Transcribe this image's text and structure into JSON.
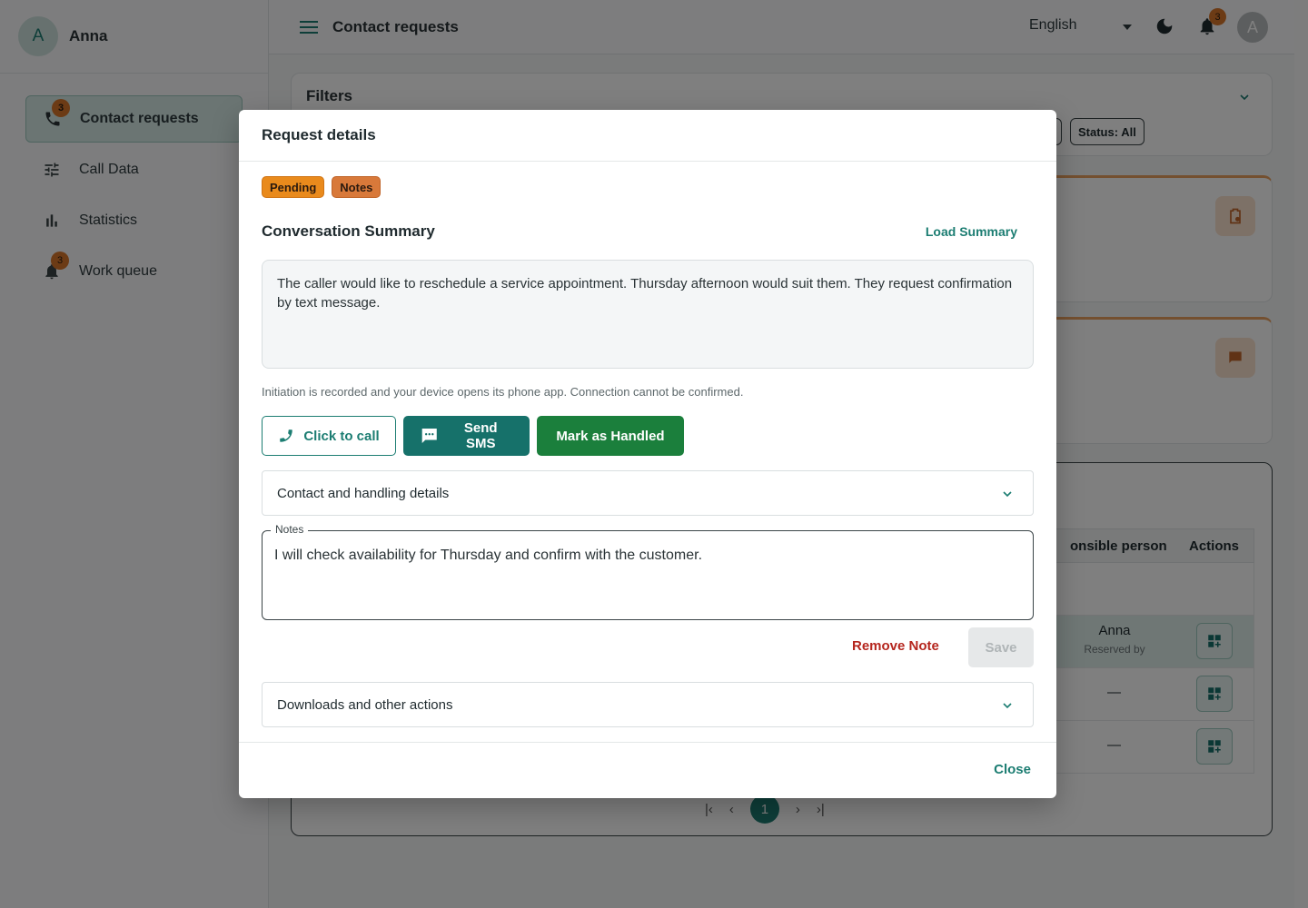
{
  "user": {
    "initial": "A",
    "name": "Anna"
  },
  "sidebar": {
    "items": [
      {
        "label": "Contact requests",
        "icon": "phone-icon",
        "badge": "3",
        "active": true
      },
      {
        "label": "Call Data",
        "icon": "sliders-icon",
        "badge": null
      },
      {
        "label": "Statistics",
        "icon": "bar-chart-icon",
        "badge": null
      },
      {
        "label": "Work queue",
        "icon": "bell-icon",
        "badge": "3"
      }
    ]
  },
  "topbar": {
    "title": "Contact requests",
    "language": "English",
    "notification_count": "3",
    "avatar_initial": "A"
  },
  "filters": {
    "title": "Filters",
    "chip_status": "Status: All"
  },
  "table": {
    "headers": {
      "responsible": "onsible person",
      "actions": "Actions"
    },
    "rows": [
      {
        "person": "",
        "person_sub": ""
      },
      {
        "person": "Anna",
        "person_sub": "Reserved by"
      },
      {
        "person": "—",
        "person_sub": ""
      },
      {
        "person": "—",
        "person_sub": ""
      }
    ]
  },
  "pagination": {
    "current": "1"
  },
  "modal": {
    "title": "Request details",
    "badges": [
      "Pending",
      "Notes"
    ],
    "summary_title": "Conversation Summary",
    "load_summary": "Load Summary",
    "summary_text": "The caller would like to reschedule a service appointment. Thursday afternoon would suit them. They request confirmation by text message.",
    "hint": "Initiation is recorded and your device opens its phone app. Connection cannot be confirmed.",
    "buttons": {
      "call": "Click to call",
      "sms": "Send SMS",
      "handled": "Mark as Handled"
    },
    "contact_details": "Contact and handling details",
    "notes_label": "Notes",
    "notes_value": "I will check availability for Thursday and confirm with the customer.",
    "remove_note": "Remove Note",
    "save": "Save",
    "downloads": "Downloads and other actions",
    "close": "Close"
  },
  "colors": {
    "primary": "#1c7d72",
    "send_sms": "#16716a",
    "mark_handled": "#1b7f3c",
    "pending_badge": "#e98a1c",
    "notes_badge": "#d8793a",
    "danger": "#b5261e"
  }
}
